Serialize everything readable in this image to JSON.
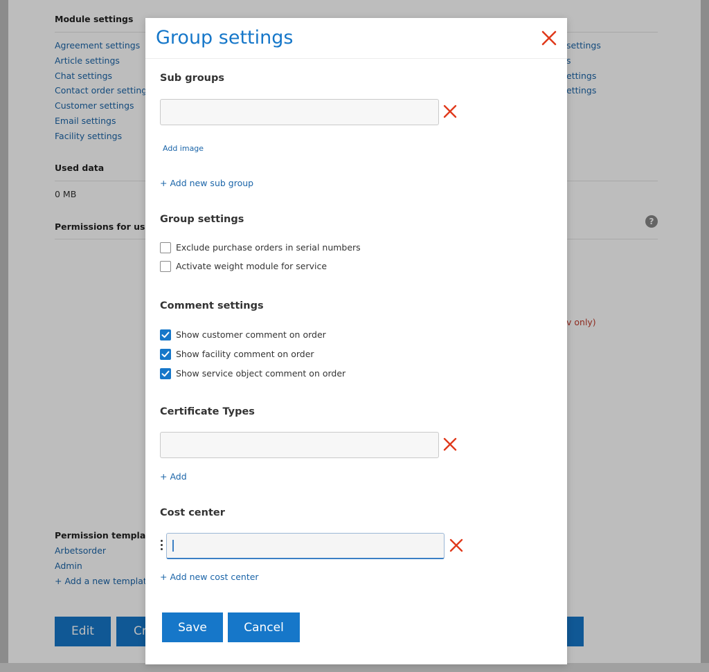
{
  "background": {
    "module_settings": {
      "heading": "Module settings",
      "left_links": [
        "Agreement settings",
        "Article settings",
        "Chat settings",
        "Contact order settings",
        "Customer settings",
        "Email settings",
        "Facility settings"
      ],
      "right_links_partial": [
        "settings",
        "s",
        "ettings",
        "ettings"
      ]
    },
    "used_data": {
      "heading": "Used data",
      "value": "0 MB"
    },
    "permissions": {
      "heading": "Permissions for users",
      "help_icon_glyph": "?",
      "partial_red_text": "v only)"
    },
    "permission_template": {
      "heading": "Permission template",
      "items": [
        "Arbetsorder",
        "Admin"
      ],
      "add_link": "+ Add a new template"
    },
    "buttons": {
      "edit": "Edit",
      "create_partial": "Cr"
    }
  },
  "modal": {
    "title": "Group settings",
    "close_icon": "close-x-icon",
    "sub_groups": {
      "title": "Sub groups",
      "input_value": "",
      "add_image_label": "Add image",
      "add_link": "+ Add new sub group"
    },
    "group_settings": {
      "title": "Group settings",
      "options": [
        {
          "label": "Exclude purchase orders in serial numbers",
          "checked": false
        },
        {
          "label": "Activate weight module for service",
          "checked": false
        }
      ]
    },
    "comment_settings": {
      "title": "Comment settings",
      "options": [
        {
          "label": "Show customer comment on order",
          "checked": true
        },
        {
          "label": "Show facility comment on order",
          "checked": true
        },
        {
          "label": "Show service object comment on order",
          "checked": true
        }
      ]
    },
    "certificate_types": {
      "title": "Certificate Types",
      "input_value": "",
      "add_link": "+ Add"
    },
    "cost_center": {
      "title": "Cost center",
      "input_value": "",
      "add_link": "+ Add new cost center"
    },
    "footer": {
      "save_label": "Save",
      "cancel_label": "Cancel"
    }
  },
  "colors": {
    "accent": "#1677c9",
    "link": "#1a64a8",
    "danger": "#e0391b"
  }
}
